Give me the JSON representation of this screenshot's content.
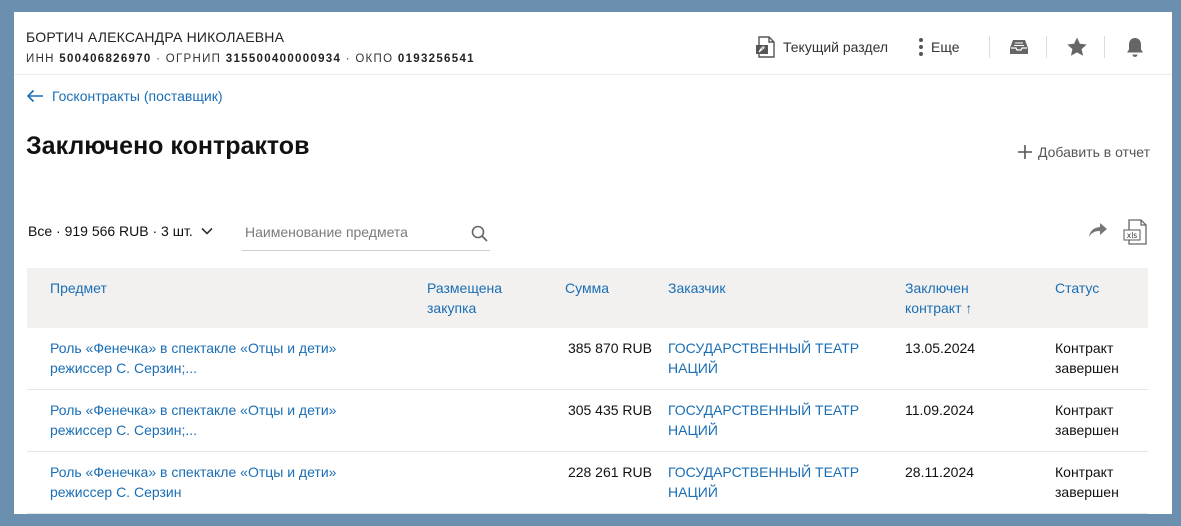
{
  "header": {
    "company_name": "БОРТИЧ АЛЕКСАНДРА НИКОЛАЕВНА",
    "inn_label": "ИНН",
    "inn_value": "500406826970",
    "ogrnip_label": "ОГРНИП",
    "ogrnip_value": "315500400000934",
    "okpo_label": "ОКПО",
    "okpo_value": "0193256541",
    "current_section_label": "Текущий раздел",
    "more_label": "Еще"
  },
  "breadcrumb": {
    "label": "Госконтракты (поставщик)"
  },
  "page": {
    "title": "Заключено контрактов",
    "add_to_report_label": "Добавить в отчет"
  },
  "filter": {
    "summary": "Все · 919 566 RUB · 3 шт.",
    "search_placeholder": "Наименование предмета",
    "search_value": ""
  },
  "table": {
    "columns": [
      {
        "key": "subject",
        "label": "Предмет"
      },
      {
        "key": "placed",
        "label": "Размещена закупка"
      },
      {
        "key": "sum",
        "label": "Сумма"
      },
      {
        "key": "customer",
        "label": "Заказчик"
      },
      {
        "key": "date",
        "label": "Заключен контракт ↑"
      },
      {
        "key": "status",
        "label": "Статус"
      }
    ],
    "rows": [
      {
        "subject": "Роль «Фенечка» в спектакле «Отцы и дети» режиссер С. Серзин;...",
        "placed": "",
        "sum": "385 870 RUB",
        "customer": "ГОСУДАРСТВЕННЫЙ ТЕАТР НАЦИЙ",
        "date": "13.05.2024",
        "status": "Контракт завершен"
      },
      {
        "subject": "Роль «Фенечка» в спектакле «Отцы и дети» режиссер С. Серзин;...",
        "placed": "",
        "sum": "305 435 RUB",
        "customer": "ГОСУДАРСТВЕННЫЙ ТЕАТР НАЦИЙ",
        "date": "11.09.2024",
        "status": "Контракт завершен"
      },
      {
        "subject": "Роль «Фенечка» в спектакле «Отцы и дети» режиссер С. Серзин",
        "placed": "",
        "sum": "228 261 RUB",
        "customer": "ГОСУДАРСТВЕННЫЙ ТЕАТР НАЦИЙ",
        "date": "28.11.2024",
        "status": "Контракт завершен"
      }
    ]
  },
  "icons": {
    "pdf": "pdf-icon",
    "more": "more-vertical-icon",
    "inbox": "inbox-icon",
    "star": "star-icon",
    "bell": "bell-icon",
    "back": "arrow-left-icon",
    "add": "plus-icon",
    "chevron": "chevron-down-icon",
    "search": "search-icon",
    "share": "share-arrow-icon",
    "xls": "xls-file-icon"
  },
  "colors": {
    "link": "#1a6eb5",
    "background": "#6b8fae",
    "table_header": "#f2f1ef"
  }
}
